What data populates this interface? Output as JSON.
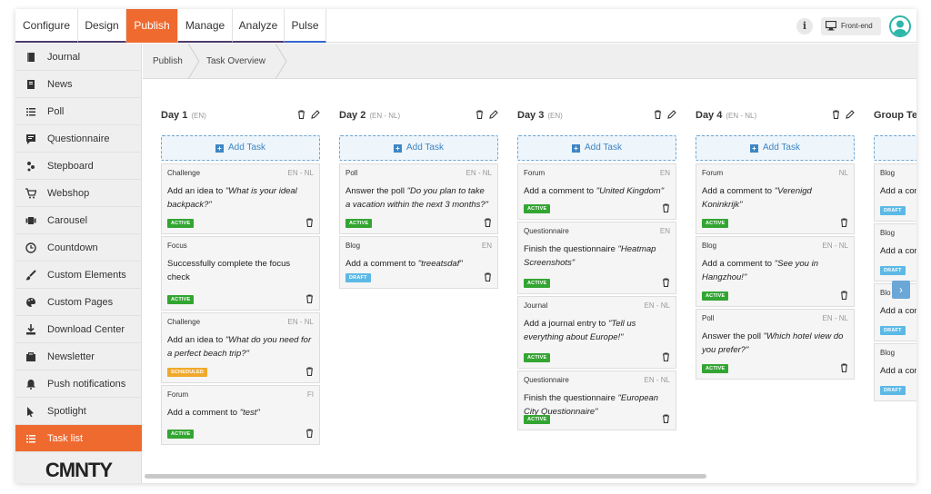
{
  "topbar": {
    "tabs": [
      {
        "label": "Configure"
      },
      {
        "label": "Design"
      },
      {
        "label": "Publish"
      },
      {
        "label": "Manage"
      },
      {
        "label": "Analyze"
      },
      {
        "label": "Pulse"
      }
    ],
    "info_label": "i",
    "frontend_label": "Front-end"
  },
  "sidebar": {
    "items": [
      {
        "label": "Journal",
        "icon": "journal-icon"
      },
      {
        "label": "News",
        "icon": "news-icon"
      },
      {
        "label": "Poll",
        "icon": "poll-icon"
      },
      {
        "label": "Questionnaire",
        "icon": "questionnaire-icon"
      },
      {
        "label": "Stepboard",
        "icon": "stepboard-icon"
      },
      {
        "label": "Webshop",
        "icon": "cart-icon"
      },
      {
        "label": "Carousel",
        "icon": "carousel-icon"
      },
      {
        "label": "Countdown",
        "icon": "clock-icon"
      },
      {
        "label": "Custom Elements",
        "icon": "brush-icon"
      },
      {
        "label": "Custom Pages",
        "icon": "palette-icon"
      },
      {
        "label": "Download Center",
        "icon": "download-icon"
      },
      {
        "label": "Newsletter",
        "icon": "newsletter-icon"
      },
      {
        "label": "Push notifications",
        "icon": "bell-icon"
      },
      {
        "label": "Spotlight",
        "icon": "spotlight-icon"
      },
      {
        "label": "Task list",
        "icon": "list-icon"
      }
    ],
    "logo": "CMNTY"
  },
  "breadcrumb": {
    "items": [
      {
        "label": "Publish"
      },
      {
        "label": "Task Overview"
      }
    ]
  },
  "add_task_label": "Add Task",
  "columns": [
    {
      "title": "Day 1",
      "lang": "(EN)",
      "cards": [
        {
          "type": "Challenge",
          "lang": "EN - NL",
          "pre": "Add an idea to ",
          "quote": "\"What is your ideal backpack?\"",
          "post": "",
          "status": "ACTIVE"
        },
        {
          "type": "Focus",
          "lang": "",
          "pre": "Successfully complete the focus check",
          "quote": "",
          "post": "",
          "status": "ACTIVE"
        },
        {
          "type": "Challenge",
          "lang": "EN - NL",
          "pre": "Add an idea to ",
          "quote": "\"What do you need for a perfect beach trip?\"",
          "post": "",
          "status": "SCHEDULED"
        },
        {
          "type": "Forum",
          "lang": "FI",
          "pre": "Add a comment to ",
          "quote": "\"test\"",
          "post": "",
          "status": "ACTIVE"
        }
      ]
    },
    {
      "title": "Day 2",
      "lang": "(EN - NL)",
      "cards": [
        {
          "type": "Poll",
          "lang": "EN - NL",
          "pre": "Answer the poll ",
          "quote": "\"Do you plan to take a vacation within the next 3 months?\"",
          "post": "",
          "status": "ACTIVE"
        },
        {
          "type": "Blog",
          "lang": "EN",
          "pre": "Add a comment to ",
          "quote": "\"treeatsdaf\"",
          "post": "",
          "status": "DRAFT"
        }
      ]
    },
    {
      "title": "Day 3",
      "lang": "(EN)",
      "cards": [
        {
          "type": "Forum",
          "lang": "EN",
          "pre": "Add a comment to ",
          "quote": "\"United Kingdom\"",
          "post": "",
          "status": "ACTIVE"
        },
        {
          "type": "Questionnaire",
          "lang": "EN",
          "pre": "Finish the questionnaire ",
          "quote": "\"Heatmap Screenshots\"",
          "post": "",
          "status": "ACTIVE"
        },
        {
          "type": "Journal",
          "lang": "EN - NL",
          "pre": "Add a journal entry to ",
          "quote": "\"Tell us everything about Europe!\"",
          "post": "",
          "status": "ACTIVE"
        },
        {
          "type": "Questionnaire",
          "lang": "EN - NL",
          "pre": "Finish the questionnaire ",
          "quote": "\"European City Questionnaire\"",
          "post": "",
          "status": "ACTIVE"
        }
      ]
    },
    {
      "title": "Day 4",
      "lang": "(EN - NL)",
      "cards": [
        {
          "type": "Forum",
          "lang": "NL",
          "pre": "Add a comment to ",
          "quote": "\"Verenigd Koninkrijk\"",
          "post": "",
          "status": "ACTIVE"
        },
        {
          "type": "Blog",
          "lang": "EN - NL",
          "pre": "Add a comment to ",
          "quote": "\"See you in Hangzhou!\"",
          "post": "",
          "status": "ACTIVE"
        },
        {
          "type": "Poll",
          "lang": "EN - NL",
          "pre": "Answer the poll ",
          "quote": "\"Which hotel view do you prefer?\"",
          "post": "",
          "status": "ACTIVE"
        }
      ]
    },
    {
      "title": "Group Tes",
      "lang": "",
      "cards": [
        {
          "type": "Blog",
          "lang": "",
          "pre": "Add a cor",
          "quote": "",
          "post": "",
          "status": "DRAFT"
        },
        {
          "type": "Blog",
          "lang": "",
          "pre": "Add a cor",
          "quote": "",
          "post": "",
          "status": "DRAFT"
        },
        {
          "type": "Blo",
          "lang": "",
          "pre": "Add a cor",
          "quote": "",
          "post": "",
          "status": "DRAFT"
        },
        {
          "type": "Blog",
          "lang": "",
          "pre": "Add a cor",
          "quote": "",
          "post": "",
          "status": "DRAFT"
        }
      ]
    }
  ],
  "colors": {
    "accent": "#ef6a2f",
    "active": "#33a532",
    "draft": "#5cb9e6",
    "scheduled": "#f0a92c",
    "link": "#3d86c4"
  }
}
